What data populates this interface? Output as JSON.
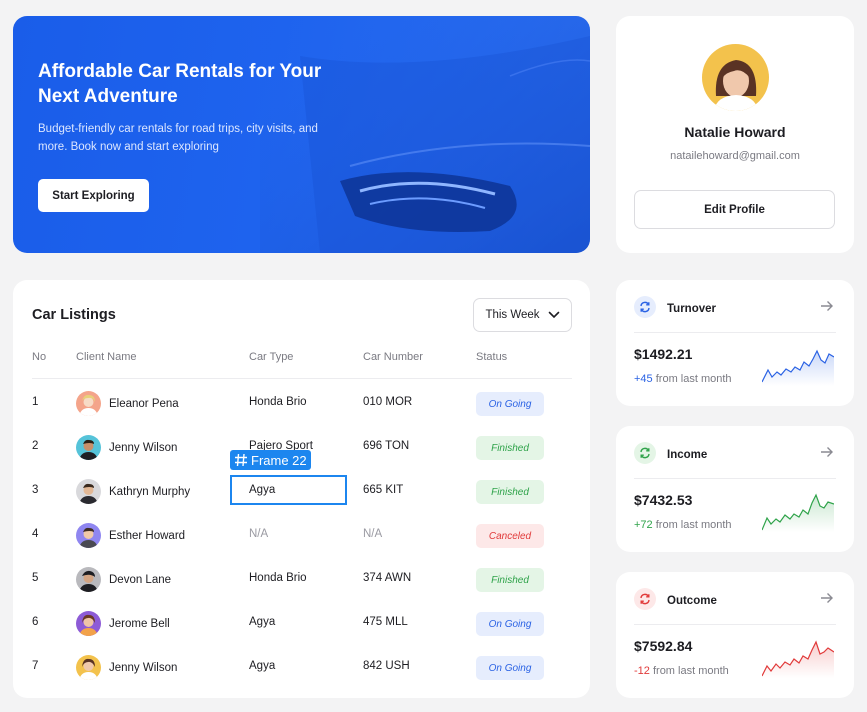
{
  "hero": {
    "title": "Affordable Car Rentals for Your Next Adventure",
    "subtitle": "Budget-friendly car rentals for road trips, city visits, and more. Book now and start exploring",
    "cta": "Start Exploring",
    "colors": {
      "primary": "#1e63ee"
    }
  },
  "profile": {
    "name": "Natalie Howard",
    "email": "natailehoward@gmail.com",
    "edit_label": "Edit Profile"
  },
  "listings": {
    "title": "Car Listings",
    "period": "This Week",
    "columns": {
      "no": "No",
      "client": "Client Name",
      "type": "Car Type",
      "number": "Car Number",
      "status": "Status"
    },
    "rows": [
      {
        "no": "1",
        "client": "Eleanor Pena",
        "type": "Honda Brio",
        "number": "010 MOR",
        "status": "On Going"
      },
      {
        "no": "2",
        "client": "Jenny Wilson",
        "type": "Pajero Sport",
        "number": "696 TON",
        "status": "Finished"
      },
      {
        "no": "3",
        "client": "Kathryn Murphy",
        "type": "Agya",
        "number": "665 KIT",
        "status": "Finished"
      },
      {
        "no": "4",
        "client": "Esther Howard",
        "type": "N/A",
        "number": "N/A",
        "status": "Canceled"
      },
      {
        "no": "5",
        "client": "Devon Lane",
        "type": "Honda Brio",
        "number": "374 AWN",
        "status": "Finished"
      },
      {
        "no": "6",
        "client": "Jerome Bell",
        "type": "Agya",
        "number": "475 MLL",
        "status": "On Going"
      },
      {
        "no": "7",
        "client": "Jenny Wilson",
        "type": "Agya",
        "number": "842 USH",
        "status": "On Going"
      }
    ]
  },
  "frame_label": "Frame 22",
  "stats": [
    {
      "label": "Turnover",
      "value": "$1492.21",
      "delta": "+45",
      "delta_suffix": "from last month",
      "color": "#2a62e4",
      "icon": "refresh-icon"
    },
    {
      "label": "Income",
      "value": "$7432.53",
      "delta": "+72",
      "delta_suffix": "from last month",
      "color": "#2fa34a",
      "icon": "refresh-icon"
    },
    {
      "label": "Outcome",
      "value": "$7592.84",
      "delta": "-12",
      "delta_suffix": "from last month",
      "color": "#e13a3a",
      "icon": "refresh-icon"
    }
  ]
}
